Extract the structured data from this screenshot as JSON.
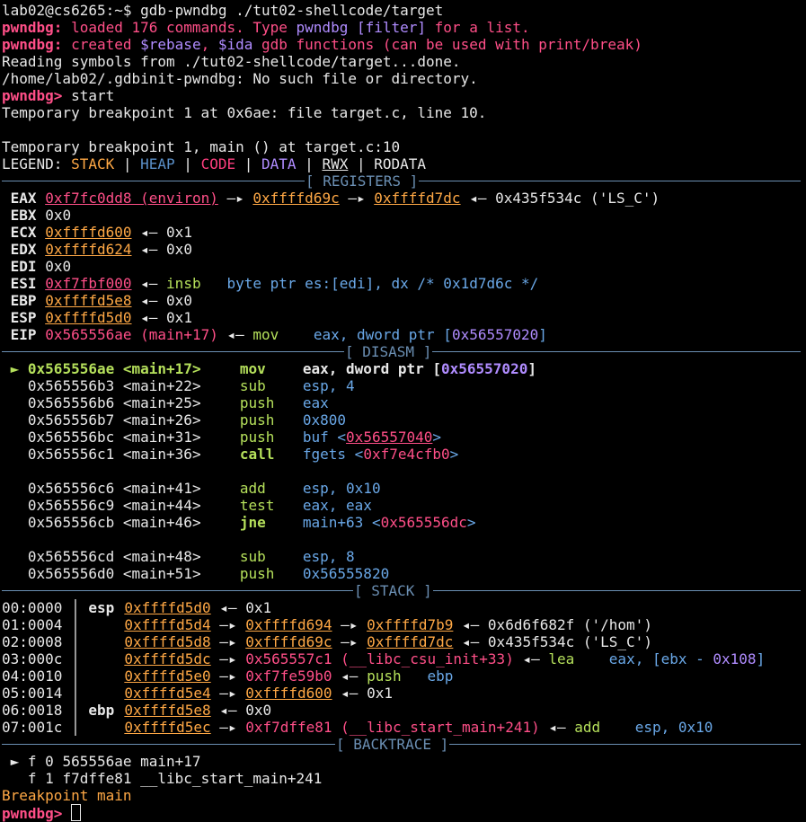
{
  "lines": {
    "cmd": "lab02@cs6265:~$ gdb-pwndbg ./tut02-shellcode/target",
    "loaded_prefix": "pwndbg:",
    "loaded_a": " loaded 176 commands. Type ",
    "loaded_b": "pwndbg [filter]",
    "loaded_c": " for a list.",
    "created_prefix": "pwndbg:",
    "created_a": " created ",
    "created_b": "$rebase",
    "created_c": ", ",
    "created_d": "$ida",
    "created_e": " gdb functions (can be used with print/break)",
    "reading": "Reading symbols from ./tut02-shellcode/target...done.",
    "gdbinit": "/home/lab02/.gdbinit-pwndbg: No such file or directory.",
    "prompt1": "pwndbg>",
    "start_cmd": " start",
    "tbp_set": "Temporary breakpoint 1 at 0x6ae: file target.c, line 10.",
    "tbp_hit": "Temporary breakpoint 1, main () at target.c:10"
  },
  "legend": {
    "label": "LEGEND: ",
    "stack": "STACK",
    "heap": "HEAP",
    "code": "CODE",
    "data": "DATA",
    "rwx": "RWX",
    "rodata": "RODATA",
    "sep": " | "
  },
  "sections": {
    "registers": "[ REGISTERS ]",
    "disasm": "[ DISASM ]",
    "stack": "[ STACK ]",
    "backtrace": "[ BACKTRACE ]"
  },
  "registers": [
    {
      "name": "EAX",
      "parts": [
        {
          "t": "0xf7fc0dd8 (environ)",
          "c": "pinku"
        },
        {
          "t": " —▸ "
        },
        {
          "t": "0xffffd69c",
          "c": "stk"
        },
        {
          "t": " —▸ "
        },
        {
          "t": "0xffffd7dc",
          "c": "stk"
        },
        {
          "t": " ◂— 0x435f534c ('LS_C')"
        }
      ]
    },
    {
      "name": "EBX",
      "parts": [
        {
          "t": "0x0"
        }
      ]
    },
    {
      "name": "ECX",
      "parts": [
        {
          "t": "0xffffd600",
          "c": "stk"
        },
        {
          "t": " ◂— 0x1"
        }
      ]
    },
    {
      "name": "EDX",
      "parts": [
        {
          "t": "0xffffd624",
          "c": "stk"
        },
        {
          "t": " ◂— 0x0"
        }
      ]
    },
    {
      "name": "EDI",
      "parts": [
        {
          "t": "0x0"
        }
      ]
    },
    {
      "name": "ESI",
      "parts": [
        {
          "t": "0xf7fbf000",
          "c": "pinku"
        },
        {
          "t": " ◂— "
        },
        {
          "t": "insb",
          "c": "green"
        },
        {
          "t": "   "
        },
        {
          "t": "byte ptr es:[edi], dx /* 0x1d7d6c */",
          "c": "cyan"
        }
      ]
    },
    {
      "name": "EBP",
      "parts": [
        {
          "t": "0xffffd5e8",
          "c": "stk"
        },
        {
          "t": " ◂— 0x0"
        }
      ]
    },
    {
      "name": "ESP",
      "parts": [
        {
          "t": "0xffffd5d0",
          "c": "stk"
        },
        {
          "t": " ◂— 0x1"
        }
      ]
    },
    {
      "name": "EIP",
      "parts": [
        {
          "t": "0x565556ae (main+17)",
          "c": "pink"
        },
        {
          "t": " ◂— "
        },
        {
          "t": "mov",
          "c": "green"
        },
        {
          "t": "    "
        },
        {
          "t": "eax, dword ptr [",
          "c": "cyan"
        },
        {
          "t": "0x56557020",
          "c": "purple"
        },
        {
          "t": "]",
          "c": "cyan"
        }
      ]
    }
  ],
  "disasm": [
    {
      "current": true,
      "marker": " ► ",
      "addr": "0x565556ae",
      "sym": "<main+17>",
      "op": "mov",
      "args": [
        {
          "t": "eax, dword ptr [",
          "c": "b"
        },
        {
          "t": "0x56557020",
          "c": "purple b"
        },
        {
          "t": "]",
          "c": "b"
        }
      ]
    },
    {
      "marker": "   ",
      "addr": "0x565556b3",
      "sym": "<main+22>",
      "op": "sub",
      "args": [
        {
          "t": "esp, 4",
          "c": "cyan"
        }
      ]
    },
    {
      "marker": "   ",
      "addr": "0x565556b6",
      "sym": "<main+25>",
      "op": "push",
      "args": [
        {
          "t": "eax",
          "c": "cyan"
        }
      ]
    },
    {
      "marker": "   ",
      "addr": "0x565556b7",
      "sym": "<main+26>",
      "op": "push",
      "args": [
        {
          "t": "0x800",
          "c": "cyan"
        }
      ]
    },
    {
      "marker": "   ",
      "addr": "0x565556bc",
      "sym": "<main+31>",
      "op": "push",
      "args": [
        {
          "t": "buf <",
          "c": "cyan"
        },
        {
          "t": "0x56557040",
          "c": "pinku"
        },
        {
          "t": ">",
          "c": "cyan"
        }
      ]
    },
    {
      "marker": "   ",
      "addr": "0x565556c1",
      "sym": "<main+36>",
      "op": "call",
      "opc": "b",
      "args": [
        {
          "t": "fgets <",
          "c": "cyan"
        },
        {
          "t": "0xf7e4cfb0",
          "c": "pink"
        },
        {
          "t": ">",
          "c": "cyan"
        }
      ]
    },
    {
      "blank": true
    },
    {
      "marker": "   ",
      "addr": "0x565556c6",
      "sym": "<main+41>",
      "op": "add",
      "args": [
        {
          "t": "esp, 0x10",
          "c": "cyan"
        }
      ]
    },
    {
      "marker": "   ",
      "addr": "0x565556c9",
      "sym": "<main+44>",
      "op": "test",
      "args": [
        {
          "t": "eax, eax",
          "c": "cyan"
        }
      ]
    },
    {
      "marker": "   ",
      "addr": "0x565556cb",
      "sym": "<main+46>",
      "op": "jne",
      "opc": "b",
      "args": [
        {
          "t": "main+63 <",
          "c": "cyan"
        },
        {
          "t": "0x565556dc",
          "c": "pink"
        },
        {
          "t": ">",
          "c": "cyan"
        }
      ]
    },
    {
      "blank": true
    },
    {
      "marker": "   ",
      "addr": "0x565556cd",
      "sym": "<main+48>",
      "op": "sub",
      "args": [
        {
          "t": "esp, 8",
          "c": "cyan"
        }
      ]
    },
    {
      "marker": "   ",
      "addr": "0x565556d0",
      "sym": "<main+51>",
      "op": "push",
      "args": [
        {
          "t": "0x56555820",
          "c": "cyan"
        }
      ]
    }
  ],
  "stack": [
    {
      "idx": "00:0000",
      "reg": "esp",
      "parts": [
        {
          "t": "0xffffd5d0",
          "c": "stk"
        },
        {
          "t": " ◂— 0x1"
        }
      ]
    },
    {
      "idx": "01:0004",
      "reg": "   ",
      "parts": [
        {
          "t": "0xffffd5d4",
          "c": "stk"
        },
        {
          "t": " —▸ "
        },
        {
          "t": "0xffffd694",
          "c": "stk"
        },
        {
          "t": " —▸ "
        },
        {
          "t": "0xffffd7b9",
          "c": "stk"
        },
        {
          "t": " ◂— 0x6d6f682f ('/hom')"
        }
      ]
    },
    {
      "idx": "02:0008",
      "reg": "   ",
      "parts": [
        {
          "t": "0xffffd5d8",
          "c": "stk"
        },
        {
          "t": " —▸ "
        },
        {
          "t": "0xffffd69c",
          "c": "stk"
        },
        {
          "t": " —▸ "
        },
        {
          "t": "0xffffd7dc",
          "c": "stk"
        },
        {
          "t": " ◂— 0x435f534c ('LS_C')"
        }
      ]
    },
    {
      "idx": "03:000c",
      "reg": "   ",
      "parts": [
        {
          "t": "0xffffd5dc",
          "c": "stk"
        },
        {
          "t": " —▸ "
        },
        {
          "t": "0x565557c1 (__libc_csu_init+33)",
          "c": "pink"
        },
        {
          "t": " ◂— "
        },
        {
          "t": "lea",
          "c": "green"
        },
        {
          "t": "    "
        },
        {
          "t": "eax, [ebx - ",
          "c": "cyan"
        },
        {
          "t": "0x108",
          "c": "purple"
        },
        {
          "t": "]",
          "c": "cyan"
        }
      ]
    },
    {
      "idx": "04:0010",
      "reg": "   ",
      "parts": [
        {
          "t": "0xffffd5e0",
          "c": "stk"
        },
        {
          "t": " —▸ "
        },
        {
          "t": "0xf7fe59b0",
          "c": "pink"
        },
        {
          "t": " ◂— "
        },
        {
          "t": "push",
          "c": "green"
        },
        {
          "t": "   "
        },
        {
          "t": "ebp",
          "c": "cyan"
        }
      ]
    },
    {
      "idx": "05:0014",
      "reg": "   ",
      "parts": [
        {
          "t": "0xffffd5e4",
          "c": "stk"
        },
        {
          "t": " —▸ "
        },
        {
          "t": "0xffffd600",
          "c": "stk"
        },
        {
          "t": " ◂— 0x1"
        }
      ]
    },
    {
      "idx": "06:0018",
      "reg": "ebp",
      "parts": [
        {
          "t": "0xffffd5e8",
          "c": "stk"
        },
        {
          "t": " ◂— 0x0"
        }
      ]
    },
    {
      "idx": "07:001c",
      "reg": "   ",
      "parts": [
        {
          "t": "0xffffd5ec",
          "c": "stk"
        },
        {
          "t": " —▸ "
        },
        {
          "t": "0xf7dffe81 (__libc_start_main+241)",
          "c": "pink"
        },
        {
          "t": " ◂— "
        },
        {
          "t": "add",
          "c": "green"
        },
        {
          "t": "    "
        },
        {
          "t": "esp, 0x10",
          "c": "cyan"
        }
      ]
    }
  ],
  "backtrace": [
    {
      "marker": " ► ",
      "text": "f 0 565556ae main+17"
    },
    {
      "marker": "   ",
      "text": "f 1 f7dffe81 __libc_start_main+241"
    }
  ],
  "footer": {
    "bp": "Breakpoint main",
    "prompt": "pwndbg>"
  },
  "colors": {
    "background": "#000000",
    "foreground": "#e8e8e8",
    "pink": "#ff4f88",
    "orange": "#ffa845",
    "green": "#b5e05b",
    "cyan": "#6aa8e8",
    "purple": "#b08cff",
    "separator": "#6b8fb3"
  }
}
